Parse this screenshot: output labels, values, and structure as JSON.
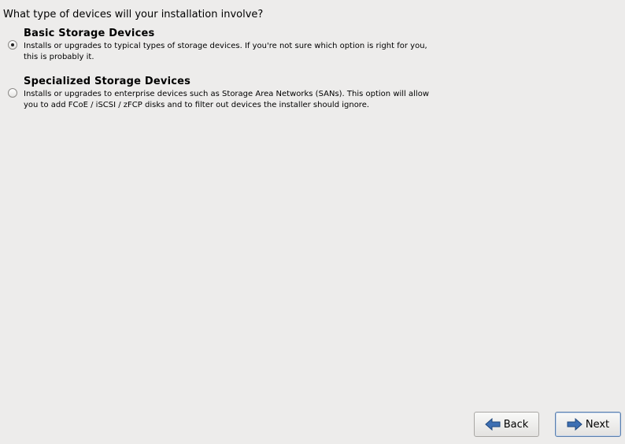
{
  "question": "What type of devices will your installation involve?",
  "options": [
    {
      "title": "Basic Storage Devices",
      "description": "Installs or upgrades to typical types of storage devices.  If you're not sure which option is right for you,\nthis is probably it.",
      "selected": true
    },
    {
      "title": "Specialized Storage Devices",
      "description": "Installs or upgrades to enterprise devices such as Storage Area Networks (SANs). This option will allow\nyou to add FCoE / iSCSI / zFCP disks and to filter out devices the installer should ignore.",
      "selected": false
    }
  ],
  "buttons": {
    "back": {
      "label": "Back",
      "icon": "arrow-left-icon"
    },
    "next": {
      "label": "Next",
      "icon": "arrow-right-icon"
    }
  },
  "colors": {
    "background": "#edeceb",
    "arrow_blue": "#3d6fb3"
  }
}
